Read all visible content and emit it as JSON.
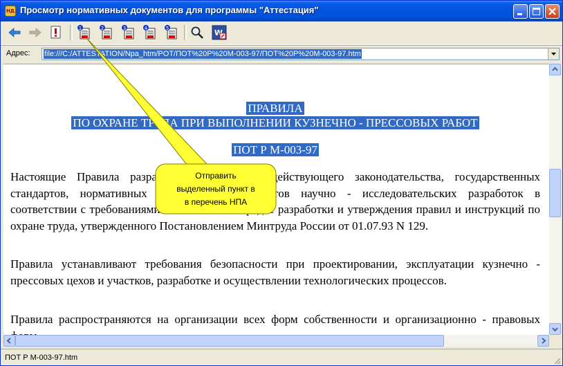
{
  "window": {
    "title": "Просмотр нормативных документов для программы \"Аттестация\"",
    "icon": "app-icon",
    "minimize_label": "minimize",
    "maximize_label": "maximize",
    "close_label": "close"
  },
  "toolbar": {
    "buttons": [
      {
        "name": "back-arrow-icon",
        "enabled": true
      },
      {
        "name": "forward-arrow-icon",
        "enabled": false
      },
      {
        "name": "important-document-icon",
        "enabled": true
      },
      {
        "name": "document-list-1-icon",
        "badge": "1"
      },
      {
        "name": "document-list-2-icon",
        "badge": "2"
      },
      {
        "name": "document-list-3-icon",
        "badge": "3"
      },
      {
        "name": "document-list-4-icon",
        "badge": "4"
      },
      {
        "name": "document-list-5-icon",
        "badge": "5"
      },
      {
        "name": "search-icon"
      },
      {
        "name": "word-export-icon"
      }
    ]
  },
  "address": {
    "label": "Адрес:",
    "value": "file:///C:/ATTESTATION/Npa_htm/POT/ПОТ%20P%20M-003-97/ПОТ%20P%20M-003-97.htm"
  },
  "document": {
    "title_line1": "ПРАВИЛА",
    "title_line2": "ПО ОХРАНЕ ТРУДА ПРИ ВЫПОЛНЕНИИ КУЗНЕЧНО - ПРЕССОВЫХ РАБОТ",
    "code": "ПОТ Р М-003-97",
    "paragraphs": [
      "Настоящие Правила разработаны на основе действующего законодательства, государственных стандартов, нормативных нормативов, результатов научно - исследовательских разработок в соответствии с требованиями Положения о порядке разработки и утверждения правил и инструкций по охране труда, утвержденного Постановлением Минтруда России от 01.07.93 N 129.",
      "Правила устанавливают требования безопасности при проектировании, эксплуатации кузнечно - прессовых цехов и участков, разработке и осуществлении технологических процессов.",
      "Правила распространяются на организации всех форм собственности и организационно - правовых форм."
    ]
  },
  "tooltip": {
    "text_line1": "Отправить",
    "text_line2": "выделенный пункт в",
    "text_line3": "в перечень НПА",
    "color": "#ffff33"
  },
  "status": {
    "text": "ПОТ Р М-003-97.htm"
  },
  "colors": {
    "selection": "#316ac5",
    "titlebar": "#0054e3",
    "chrome": "#ece9d8"
  }
}
